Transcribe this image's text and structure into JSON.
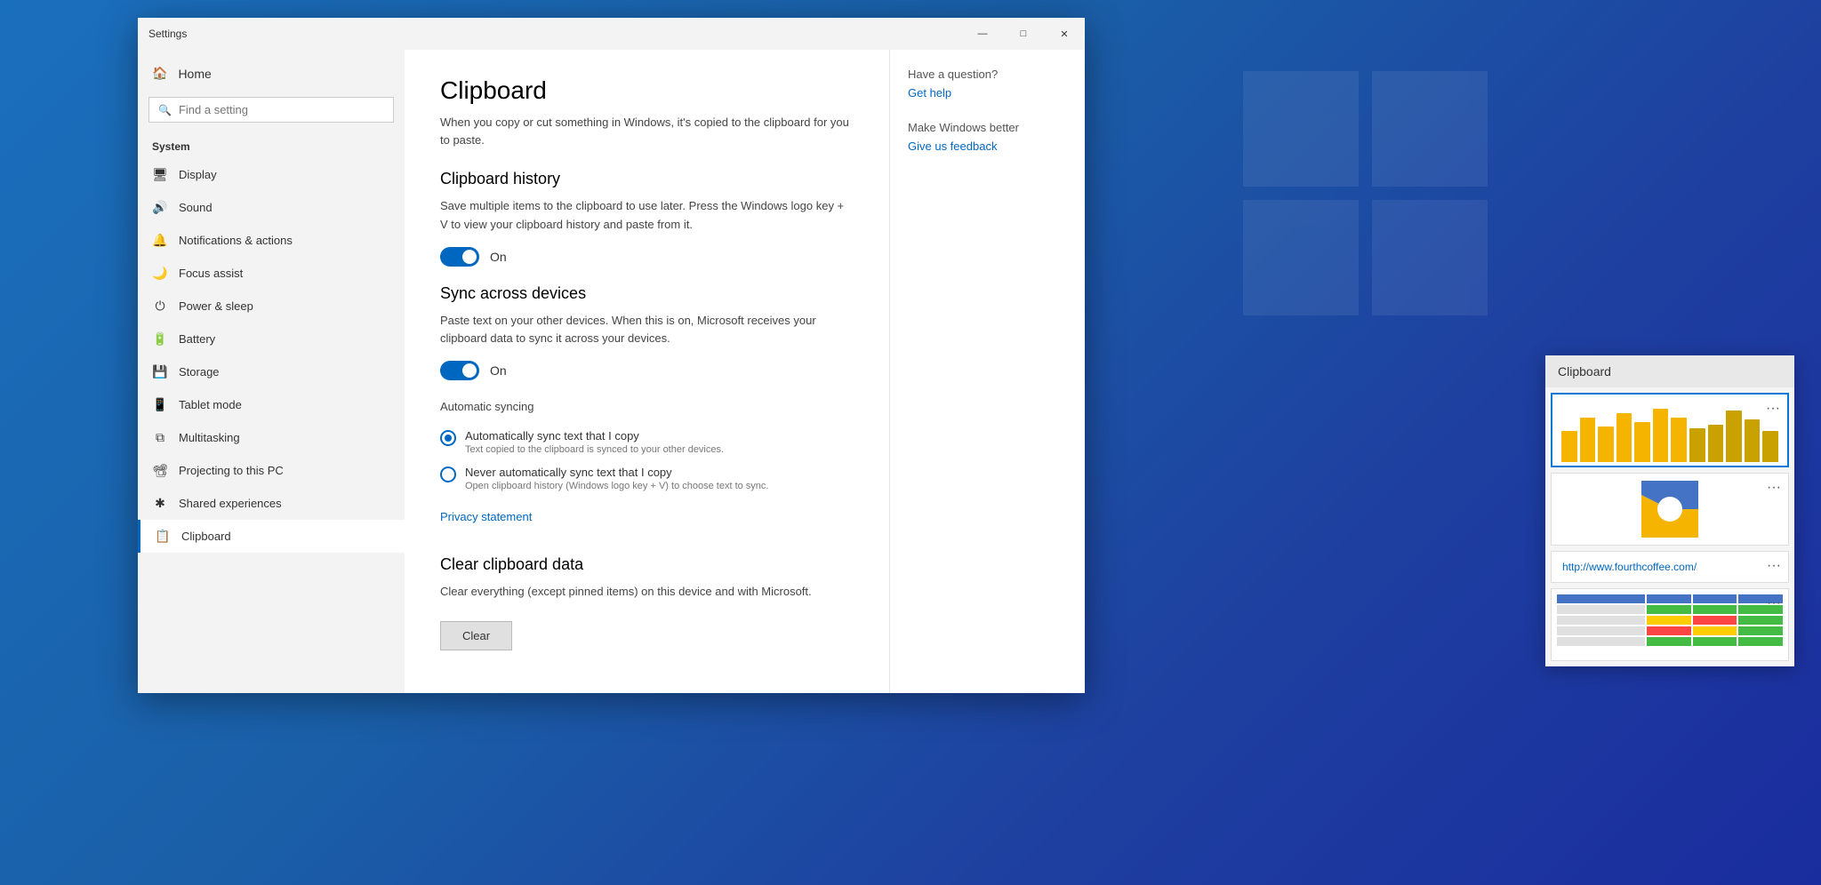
{
  "window": {
    "title": "Settings",
    "minimize_label": "—",
    "maximize_label": "□",
    "close_label": "✕"
  },
  "sidebar": {
    "home_label": "Home",
    "search_placeholder": "Find a setting",
    "section_label": "System",
    "items": [
      {
        "id": "display",
        "icon": "🖥",
        "label": "Display"
      },
      {
        "id": "sound",
        "icon": "🔊",
        "label": "Sound"
      },
      {
        "id": "notifications",
        "icon": "🔔",
        "label": "Notifications & actions"
      },
      {
        "id": "focus",
        "icon": "🌙",
        "label": "Focus assist"
      },
      {
        "id": "power",
        "icon": "⏻",
        "label": "Power & sleep"
      },
      {
        "id": "battery",
        "icon": "🔋",
        "label": "Battery"
      },
      {
        "id": "storage",
        "icon": "💾",
        "label": "Storage"
      },
      {
        "id": "tablet",
        "icon": "📱",
        "label": "Tablet mode"
      },
      {
        "id": "multitasking",
        "icon": "⧉",
        "label": "Multitasking"
      },
      {
        "id": "projecting",
        "icon": "📽",
        "label": "Projecting to this PC"
      },
      {
        "id": "shared",
        "icon": "✱",
        "label": "Shared experiences"
      },
      {
        "id": "clipboard",
        "icon": "📋",
        "label": "Clipboard"
      }
    ]
  },
  "main": {
    "title": "Clipboard",
    "description": "When you copy or cut something in Windows, it's copied to the clipboard for you to paste.",
    "clipboard_history": {
      "title": "Clipboard history",
      "description": "Save multiple items to the clipboard to use later. Press the Windows logo key + V to view your clipboard history and paste from it.",
      "toggle_state": "on",
      "toggle_label": "On"
    },
    "sync_devices": {
      "title": "Sync across devices",
      "description": "Paste text on your other devices. When this is on, Microsoft receives your clipboard data to sync it across your devices.",
      "toggle_state": "on",
      "toggle_label": "On",
      "auto_sync_label": "Automatic syncing",
      "radio_auto_label": "Automatically sync text that I copy",
      "radio_auto_sub": "Text copied to the clipboard is synced to your other devices.",
      "radio_manual_label": "Never automatically sync text that I copy",
      "radio_manual_sub": "Open clipboard history (Windows logo key + V) to choose text to sync."
    },
    "privacy_link": "Privacy statement",
    "clear_section": {
      "title": "Clear clipboard data",
      "description": "Clear everything (except pinned items) on this device and with Microsoft.",
      "clear_button": "Clear"
    }
  },
  "right_panel": {
    "question_title": "Have a question?",
    "get_help_link": "Get help",
    "better_title": "Make Windows better",
    "feedback_link": "Give us feedback"
  },
  "clipboard_panel": {
    "title": "Clipboard",
    "url_item": "http://www.fourthcoffee.com/",
    "more_label": "···"
  }
}
